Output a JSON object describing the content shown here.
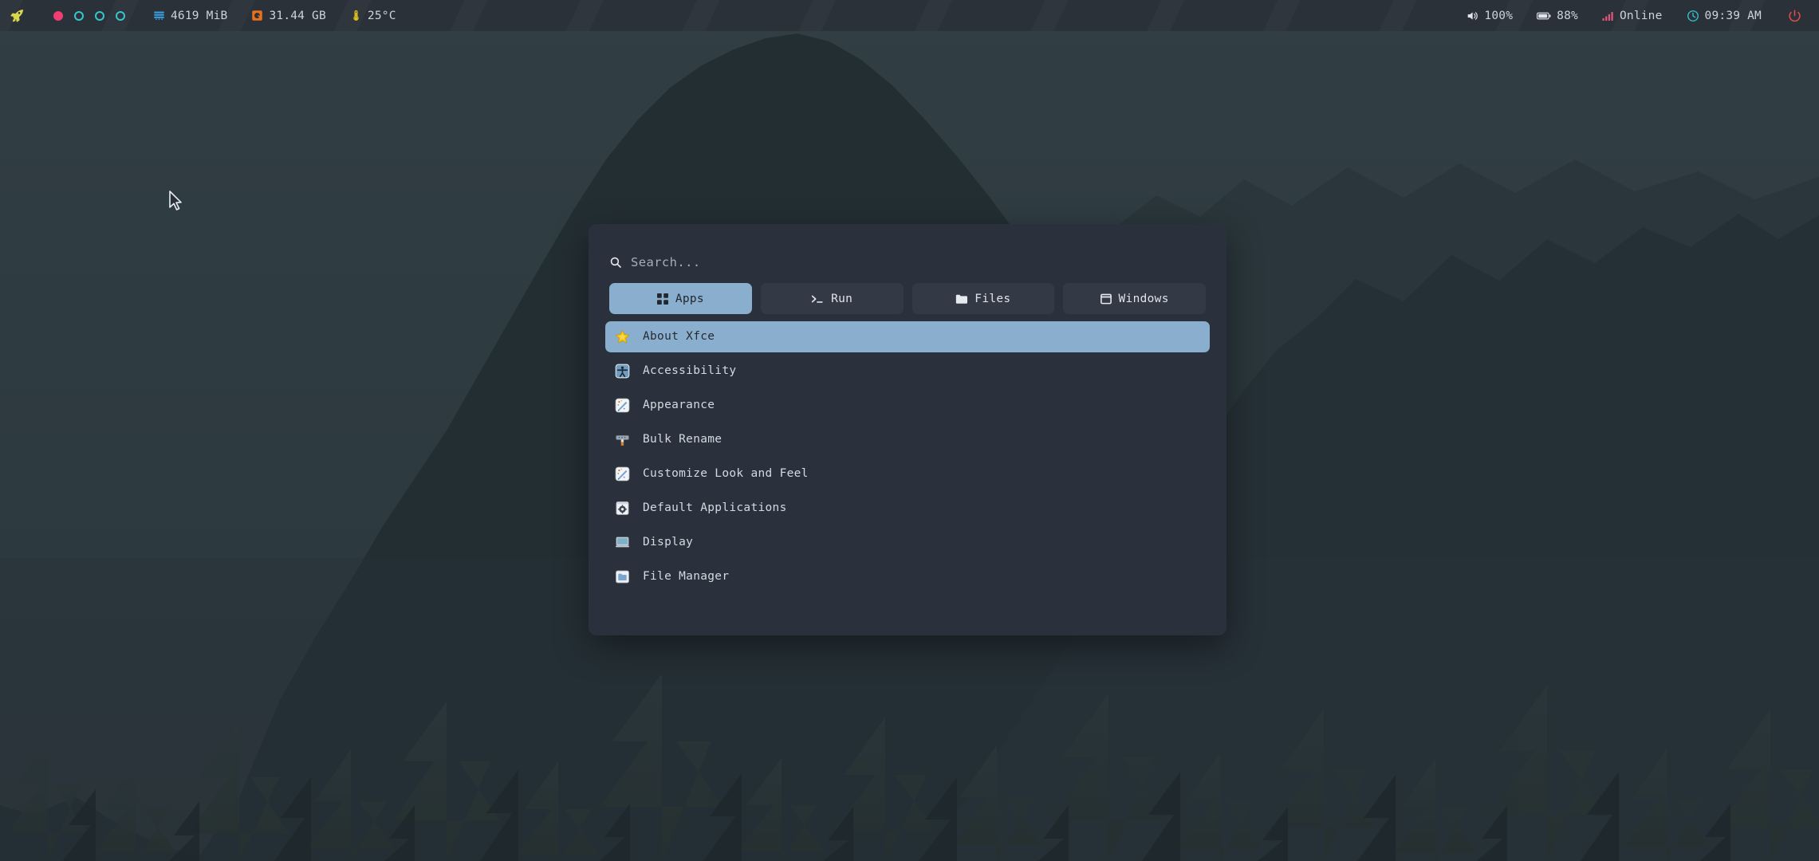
{
  "panel": {
    "launcher_icon": "rocket-icon",
    "workspaces": [
      {
        "name": "workspace-1",
        "state": "active"
      },
      {
        "name": "workspace-2",
        "state": "idle"
      },
      {
        "name": "workspace-3",
        "state": "idle"
      },
      {
        "name": "workspace-4",
        "state": "idle"
      }
    ],
    "left_items": [
      {
        "icon": "memory-icon",
        "label": "4619 MiB",
        "color": "#3a9ede"
      },
      {
        "icon": "harddisk-icon",
        "label": "31.44 GB",
        "color": "#e8711a"
      },
      {
        "icon": "thermometer-icon",
        "label": "25°C",
        "color": "#e8c61a"
      }
    ],
    "right_items": [
      {
        "icon": "volume-icon",
        "label": "100%",
        "color": "#dfe5eb"
      },
      {
        "icon": "battery-icon",
        "label": "88%",
        "color": "#dfe5eb"
      },
      {
        "icon": "network-signal-icon",
        "label": "Online",
        "color": "#e0547e"
      },
      {
        "icon": "clock-icon",
        "label": "09:39 AM",
        "color": "#35c7cf"
      }
    ],
    "power_button": {
      "icon": "power-icon",
      "color": "#e04a4a"
    }
  },
  "launcher": {
    "search": {
      "icon": "search-icon",
      "value": "",
      "placeholder": "Search..."
    },
    "tabs": [
      {
        "id": "apps",
        "label": "Apps",
        "icon": "grid-icon",
        "active": true
      },
      {
        "id": "run",
        "label": "Run",
        "icon": "terminal-icon",
        "active": false
      },
      {
        "id": "files",
        "label": "Files",
        "icon": "folder-icon",
        "active": false
      },
      {
        "id": "windows",
        "label": "Windows",
        "icon": "window-icon",
        "active": false
      }
    ],
    "apps": [
      {
        "label": "About Xfce",
        "icon": "star-icon",
        "selected": true
      },
      {
        "label": "Accessibility",
        "icon": "accessibility-icon",
        "selected": false
      },
      {
        "label": "Appearance",
        "icon": "appearance-icon",
        "selected": false
      },
      {
        "label": "Bulk Rename",
        "icon": "bulk-rename-icon",
        "selected": false
      },
      {
        "label": "Customize Look and Feel",
        "icon": "appearance-icon",
        "selected": false
      },
      {
        "label": "Default Applications",
        "icon": "default-apps-icon",
        "selected": false
      },
      {
        "label": "Display",
        "icon": "display-icon",
        "selected": false
      },
      {
        "label": "File Manager",
        "icon": "file-manager-icon",
        "selected": false
      }
    ]
  },
  "colors": {
    "panel_bg": "#2b3139",
    "dialog_bg": "#2b313c",
    "accent": "#8aaecd",
    "tab_bg": "#333a46",
    "text": "#d4dae1",
    "desktop_sky": "#2f3c41",
    "desktop_mountain": "#232e33",
    "desktop_trees": "#212b30"
  }
}
